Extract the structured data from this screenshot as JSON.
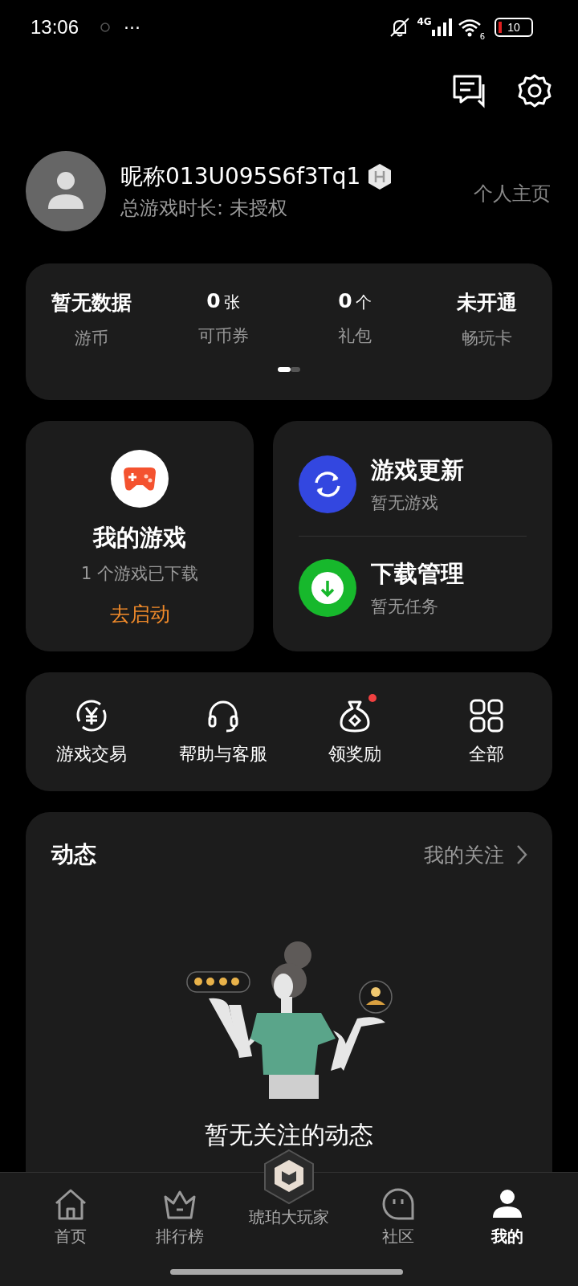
{
  "status_bar": {
    "time": "13:06",
    "more": "···",
    "network": "4G",
    "wifi_band": "6",
    "battery": "10"
  },
  "profile": {
    "nickname": "昵称013U095S6f3Tq1",
    "playtime": "总游戏时长: 未授权",
    "homepage_link": "个人主页"
  },
  "stats": {
    "items": [
      {
        "value": "暂无数据",
        "label": "游币"
      },
      {
        "value": "0",
        "unit": "张",
        "label": "可币券"
      },
      {
        "value": "0",
        "unit": "个",
        "label": "礼包"
      },
      {
        "value": "未开通",
        "label": "畅玩卡"
      }
    ],
    "pages": [
      {
        "selected": true
      },
      {
        "selected": false
      }
    ]
  },
  "my_games": {
    "title": "我的游戏",
    "subtitle": "1 个游戏已下载",
    "action": "去启动"
  },
  "quick": [
    {
      "kind": "update",
      "title": "游戏更新",
      "subtitle": "暂无游戏",
      "color": "#3347e0"
    },
    {
      "kind": "download",
      "title": "下载管理",
      "subtitle": "暂无任务",
      "color": "#17b82c"
    }
  ],
  "shortcuts": [
    {
      "kind": "trade",
      "label": "游戏交易",
      "badge": false
    },
    {
      "kind": "help",
      "label": "帮助与客服",
      "badge": false
    },
    {
      "kind": "reward",
      "label": "领奖励",
      "badge": true
    },
    {
      "kind": "all",
      "label": "全部",
      "badge": false
    }
  ],
  "feed": {
    "title": "动态",
    "follow_link": "我的关注",
    "empty_text": "暂无关注的动态"
  },
  "nav": [
    {
      "kind": "home",
      "label": "首页",
      "selected": false
    },
    {
      "kind": "rank",
      "label": "排行榜",
      "selected": false
    },
    {
      "kind": "center",
      "label": "琥珀大玩家",
      "selected": false
    },
    {
      "kind": "community",
      "label": "社区",
      "selected": false
    },
    {
      "kind": "me",
      "label": "我的",
      "selected": true
    }
  ]
}
